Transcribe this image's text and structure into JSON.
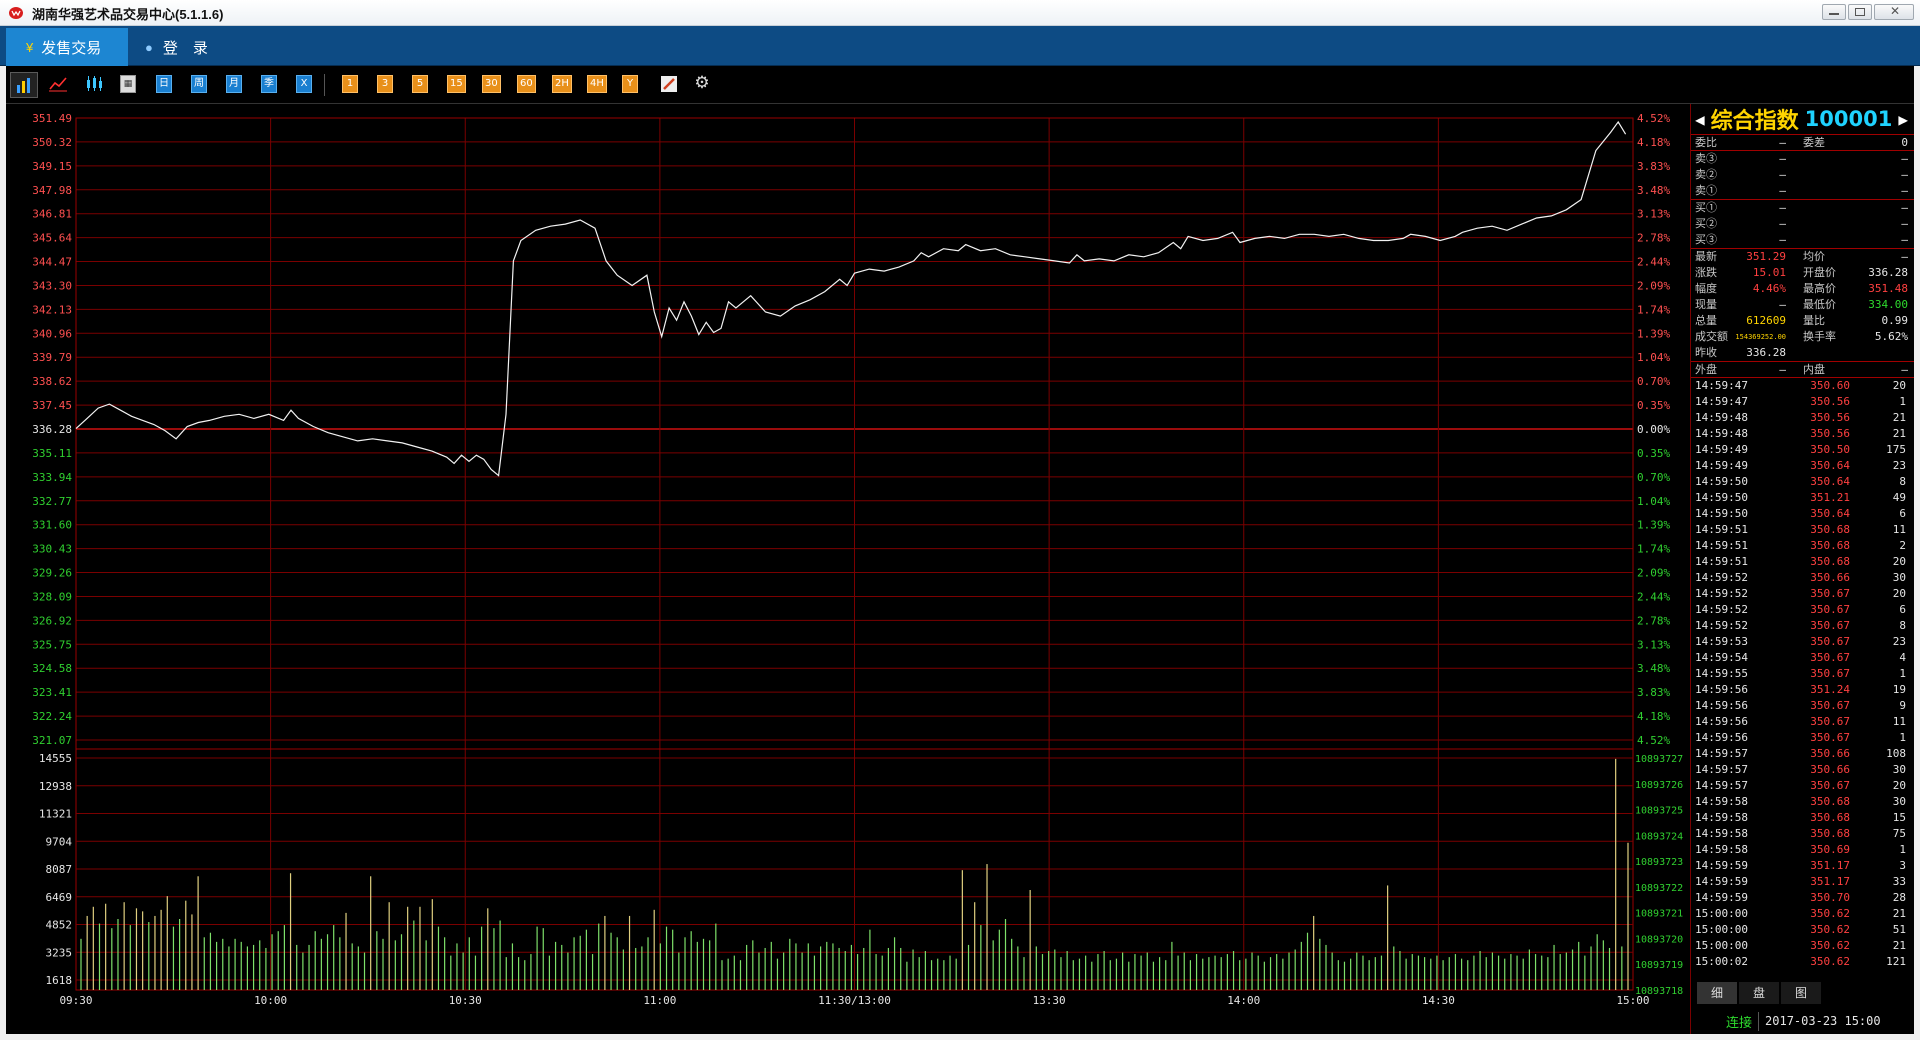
{
  "window": {
    "title": "湖南华强艺术品交易中心(5.1.1.6)"
  },
  "tabs": {
    "trade": "发售交易",
    "login": "登　录"
  },
  "toolbar": {
    "period_buttons": [
      "日",
      "周",
      "月",
      "季",
      "X"
    ],
    "minute_buttons": [
      "1",
      "3",
      "5",
      "15",
      "30",
      "60",
      "2H",
      "4H",
      "Y"
    ]
  },
  "quote": {
    "name": "综合指数",
    "code": "100001",
    "weibi_label": "委比",
    "weibi_val": "—",
    "weicha_label": "委差",
    "weicha_val": "0",
    "sells": [
      {
        "label": "卖③",
        "price": "—",
        "vol": "—"
      },
      {
        "label": "卖②",
        "price": "—",
        "vol": "—"
      },
      {
        "label": "卖①",
        "price": "—",
        "vol": "—"
      }
    ],
    "buys": [
      {
        "label": "买①",
        "price": "—",
        "vol": "—"
      },
      {
        "label": "买②",
        "price": "—",
        "vol": "—"
      },
      {
        "label": "买③",
        "price": "—",
        "vol": "—"
      }
    ],
    "stats": [
      {
        "l1": "最新",
        "v1": "351.29",
        "l2": "均价",
        "v2": "—"
      },
      {
        "l1": "涨跌",
        "v1": "15.01",
        "l2": "开盘价",
        "v2": "336.28"
      },
      {
        "l1": "幅度",
        "v1": "4.46%",
        "l2": "最高价",
        "v2": "351.48"
      },
      {
        "l1": "现量",
        "v1": "—",
        "l2": "最低价",
        "v2": "334.00"
      },
      {
        "l1": "总量",
        "v1": "612609",
        "l2": "量比",
        "v2": "0.99"
      },
      {
        "l1": "成交额",
        "v1": "154369252.00",
        "l2": "换手率",
        "v2": "5.62%"
      },
      {
        "l1": "昨收",
        "v1": "336.28",
        "l2": "",
        "v2": ""
      }
    ],
    "outer_label": "外盘",
    "outer_val": "—",
    "inner_label": "内盘",
    "inner_val": "—",
    "ticks": [
      [
        "14:59:47",
        "350.60",
        "20"
      ],
      [
        "14:59:47",
        "350.56",
        "1"
      ],
      [
        "14:59:48",
        "350.56",
        "21"
      ],
      [
        "14:59:48",
        "350.56",
        "21"
      ],
      [
        "14:59:49",
        "350.50",
        "175"
      ],
      [
        "14:59:49",
        "350.64",
        "23"
      ],
      [
        "14:59:50",
        "350.64",
        "8"
      ],
      [
        "14:59:50",
        "351.21",
        "49"
      ],
      [
        "14:59:50",
        "350.64",
        "6"
      ],
      [
        "14:59:51",
        "350.68",
        "11"
      ],
      [
        "14:59:51",
        "350.68",
        "2"
      ],
      [
        "14:59:51",
        "350.68",
        "20"
      ],
      [
        "14:59:52",
        "350.66",
        "30"
      ],
      [
        "14:59:52",
        "350.67",
        "20"
      ],
      [
        "14:59:52",
        "350.67",
        "6"
      ],
      [
        "14:59:52",
        "350.67",
        "8"
      ],
      [
        "14:59:53",
        "350.67",
        "23"
      ],
      [
        "14:59:54",
        "350.67",
        "4"
      ],
      [
        "14:59:55",
        "350.67",
        "1"
      ],
      [
        "14:59:56",
        "351.24",
        "19"
      ],
      [
        "14:59:56",
        "350.67",
        "9"
      ],
      [
        "14:59:56",
        "350.67",
        "11"
      ],
      [
        "14:59:56",
        "350.67",
        "1"
      ],
      [
        "14:59:57",
        "350.66",
        "108"
      ],
      [
        "14:59:57",
        "350.66",
        "30"
      ],
      [
        "14:59:57",
        "350.67",
        "20"
      ],
      [
        "14:59:58",
        "350.68",
        "30"
      ],
      [
        "14:59:58",
        "350.68",
        "15"
      ],
      [
        "14:59:58",
        "350.68",
        "75"
      ],
      [
        "14:59:58",
        "350.69",
        "1"
      ],
      [
        "14:59:59",
        "351.17",
        "3"
      ],
      [
        "14:59:59",
        "351.17",
        "33"
      ],
      [
        "14:59:59",
        "350.70",
        "28"
      ],
      [
        "15:00:00",
        "350.62",
        "21"
      ],
      [
        "15:00:00",
        "350.62",
        "51"
      ],
      [
        "15:00:00",
        "350.62",
        "21"
      ],
      [
        "15:00:02",
        "350.62",
        "121"
      ]
    ],
    "bottom_tabs": [
      "细",
      "盘",
      "图"
    ]
  },
  "status": {
    "connection": "连接",
    "datetime": "2017-03-23 15:00"
  },
  "chart_data": {
    "type": "line",
    "price_ticks": [
      "351.49",
      "350.32",
      "349.15",
      "347.98",
      "346.81",
      "345.64",
      "344.47",
      "343.30",
      "342.13",
      "340.96",
      "339.79",
      "338.62",
      "337.45",
      "336.28",
      "335.11",
      "333.94",
      "332.77",
      "331.60",
      "330.43",
      "329.26",
      "328.09",
      "326.92",
      "325.75",
      "324.58",
      "323.41",
      "322.24",
      "321.07"
    ],
    "pct_ticks": [
      "4.52%",
      "4.18%",
      "3.83%",
      "3.48%",
      "3.13%",
      "2.78%",
      "2.44%",
      "2.09%",
      "1.74%",
      "1.39%",
      "1.04%",
      "0.70%",
      "0.35%",
      "0.00%",
      "0.35%",
      "0.70%",
      "1.04%",
      "1.39%",
      "1.74%",
      "2.09%",
      "2.44%",
      "2.78%",
      "3.13%",
      "3.48%",
      "3.83%",
      "4.18%",
      "4.52%"
    ],
    "vol_ticks_left": [
      "14555",
      "12938",
      "11321",
      "9704",
      "8087",
      "6469",
      "4852",
      "3235",
      "1618"
    ],
    "vol_ticks_right": [
      "10893727",
      "10893726",
      "10893725",
      "10893724",
      "10893723",
      "10893722",
      "10893721",
      "10893720",
      "10893719",
      "10893718"
    ],
    "time_labels": [
      "09:30",
      "10:00",
      "10:30",
      "11:00",
      "11:30/13:00",
      "13:30",
      "14:00",
      "14:30",
      "15:00"
    ],
    "ylim": [
      321.07,
      351.49
    ],
    "vol_max": 14555,
    "prev_close": 336.28,
    "price_series": [
      [
        0,
        336.3
      ],
      [
        3,
        336.8
      ],
      [
        6,
        337.3
      ],
      [
        9,
        337.5
      ],
      [
        12,
        337.2
      ],
      [
        15,
        336.9
      ],
      [
        18,
        336.7
      ],
      [
        21,
        336.5
      ],
      [
        24,
        336.2
      ],
      [
        27,
        335.8
      ],
      [
        30,
        336.4
      ],
      [
        33,
        336.6
      ],
      [
        36,
        336.7
      ],
      [
        40,
        336.9
      ],
      [
        44,
        337.0
      ],
      [
        48,
        336.8
      ],
      [
        52,
        337.0
      ],
      [
        56,
        336.7
      ],
      [
        58,
        337.2
      ],
      [
        60,
        336.8
      ],
      [
        64,
        336.4
      ],
      [
        68,
        336.1
      ],
      [
        72,
        335.9
      ],
      [
        76,
        335.7
      ],
      [
        80,
        335.8
      ],
      [
        84,
        335.7
      ],
      [
        88,
        335.6
      ],
      [
        92,
        335.4
      ],
      [
        96,
        335.2
      ],
      [
        100,
        334.9
      ],
      [
        102,
        334.6
      ],
      [
        104,
        335.0
      ],
      [
        106,
        334.7
      ],
      [
        108,
        335.0
      ],
      [
        110,
        334.8
      ],
      [
        112,
        334.3
      ],
      [
        114,
        334.0
      ],
      [
        116,
        337.0
      ],
      [
        118,
        344.5
      ],
      [
        120,
        345.5
      ],
      [
        124,
        346.0
      ],
      [
        128,
        346.2
      ],
      [
        132,
        346.3
      ],
      [
        136,
        346.5
      ],
      [
        140,
        346.1
      ],
      [
        143,
        344.5
      ],
      [
        146,
        343.8
      ],
      [
        150,
        343.3
      ],
      [
        154,
        343.8
      ],
      [
        156,
        342.0
      ],
      [
        158,
        340.8
      ],
      [
        160,
        342.2
      ],
      [
        162,
        341.6
      ],
      [
        164,
        342.5
      ],
      [
        166,
        341.8
      ],
      [
        168,
        340.9
      ],
      [
        170,
        341.5
      ],
      [
        172,
        341.0
      ],
      [
        174,
        341.2
      ],
      [
        176,
        342.5
      ],
      [
        178,
        342.2
      ],
      [
        182,
        342.8
      ],
      [
        186,
        342.0
      ],
      [
        190,
        341.8
      ],
      [
        194,
        342.3
      ],
      [
        198,
        342.6
      ],
      [
        202,
        343.0
      ],
      [
        206,
        343.6
      ],
      [
        208,
        343.3
      ],
      [
        210,
        343.9
      ],
      [
        214,
        344.1
      ],
      [
        218,
        344.0
      ],
      [
        222,
        344.2
      ],
      [
        226,
        344.5
      ],
      [
        228,
        344.9
      ],
      [
        230,
        344.7
      ],
      [
        234,
        345.1
      ],
      [
        238,
        345.0
      ],
      [
        240,
        345.3
      ],
      [
        244,
        345.0
      ],
      [
        248,
        345.1
      ],
      [
        252,
        344.8
      ],
      [
        256,
        344.7
      ],
      [
        260,
        344.6
      ],
      [
        264,
        344.5
      ],
      [
        268,
        344.4
      ],
      [
        270,
        344.8
      ],
      [
        272,
        344.5
      ],
      [
        276,
        344.6
      ],
      [
        280,
        344.5
      ],
      [
        284,
        344.8
      ],
      [
        288,
        344.7
      ],
      [
        292,
        344.9
      ],
      [
        296,
        345.4
      ],
      [
        298,
        345.1
      ],
      [
        300,
        345.7
      ],
      [
        304,
        345.5
      ],
      [
        308,
        345.6
      ],
      [
        312,
        345.9
      ],
      [
        314,
        345.4
      ],
      [
        318,
        345.6
      ],
      [
        322,
        345.7
      ],
      [
        326,
        345.6
      ],
      [
        330,
        345.8
      ],
      [
        334,
        345.8
      ],
      [
        338,
        345.7
      ],
      [
        342,
        345.8
      ],
      [
        346,
        345.6
      ],
      [
        350,
        345.5
      ],
      [
        354,
        345.5
      ],
      [
        358,
        345.6
      ],
      [
        360,
        345.8
      ],
      [
        364,
        345.7
      ],
      [
        368,
        345.5
      ],
      [
        372,
        345.7
      ],
      [
        374,
        345.9
      ],
      [
        378,
        346.1
      ],
      [
        382,
        346.2
      ],
      [
        386,
        346.0
      ],
      [
        390,
        346.3
      ],
      [
        394,
        346.6
      ],
      [
        398,
        346.7
      ],
      [
        402,
        347.0
      ],
      [
        406,
        347.5
      ],
      [
        410,
        349.9
      ],
      [
        414,
        350.8
      ],
      [
        416,
        351.3
      ],
      [
        418,
        350.7
      ]
    ],
    "volume_series": [
      2700,
      4200,
      4800,
      3700,
      5000,
      3400,
      4000,
      5100,
      3600,
      4700,
      4500,
      3800,
      4200,
      4600,
      5500,
      3500,
      4000,
      5200,
      4300,
      6800,
      2800,
      3100,
      2500,
      2700,
      2200,
      2700,
      2500,
      2200,
      2300,
      2600,
      2100,
      3000,
      3200,
      3600,
      7000,
      2300,
      1800,
      2300,
      3200,
      2700,
      3000,
      3600,
      2800,
      4400,
      2400,
      2200,
      1800,
      6800,
      3200,
      2700,
      5100,
      2600,
      3000,
      4800,
      3900,
      4800,
      2600,
      5300,
      3500,
      2800,
      1600,
      2400,
      1800,
      2800,
      1600,
      3500,
      4700,
      3400,
      3900,
      1500,
      2400,
      1500,
      1300,
      1700,
      3500,
      3400,
      1600,
      2500,
      2300,
      1800,
      2800,
      2900,
      3300,
      1700,
      3700,
      4200,
      3100,
      2800,
      2000,
      4200,
      2100,
      2200,
      2800,
      4600,
      2400,
      3500,
      3300,
      1800,
      2800,
      3200,
      2500,
      2700,
      2600,
      3700,
      1300,
      1400,
      1600,
      1300,
      2300,
      2600,
      1800,
      2100,
      2500,
      1400,
      1800,
      2700,
      2400,
      1800,
      2400,
      1600,
      2200,
      2500,
      2400,
      2100,
      1900,
      2300,
      1700,
      2100,
      3300,
      1700,
      1600,
      2100,
      2800,
      2100,
      1200,
      2000,
      1500,
      1900,
      1300,
      1400,
      1300,
      1600,
      1400,
      7200,
      2300,
      5100,
      3600,
      7600,
      2600,
      3300,
      4000,
      2700,
      2200,
      1500,
      5900,
      2200,
      1700,
      1900,
      2000,
      1500,
      1900,
      1300,
      1400,
      1600,
      1200,
      1700,
      1900,
      1300,
      1400,
      1800,
      1200,
      1700,
      1600,
      1800,
      1200,
      1500,
      1300,
      2500,
      1600,
      1800,
      1300,
      1700,
      1400,
      1500,
      1600,
      1500,
      1700,
      1900,
      1300,
      1400,
      1800,
      1600,
      1200,
      1500,
      1700,
      1400,
      1800,
      2000,
      2500,
      3100,
      4200,
      2700,
      2300,
      1800,
      1300,
      1200,
      1400,
      1800,
      1600,
      1300,
      1500,
      1600,
      6200,
      2200,
      1900,
      1400,
      1700,
      1600,
      1500,
      1400,
      1600,
      1300,
      1500,
      1700,
      1400,
      1300,
      1600,
      1900,
      1500,
      1800,
      1600,
      1400,
      1700,
      1600,
      1400,
      2000,
      1700,
      1600,
      1500,
      2300,
      1700,
      1800,
      2000,
      2500,
      1600,
      2200,
      3000,
      2600,
      2100,
      14500,
      2200,
      9000
    ]
  }
}
